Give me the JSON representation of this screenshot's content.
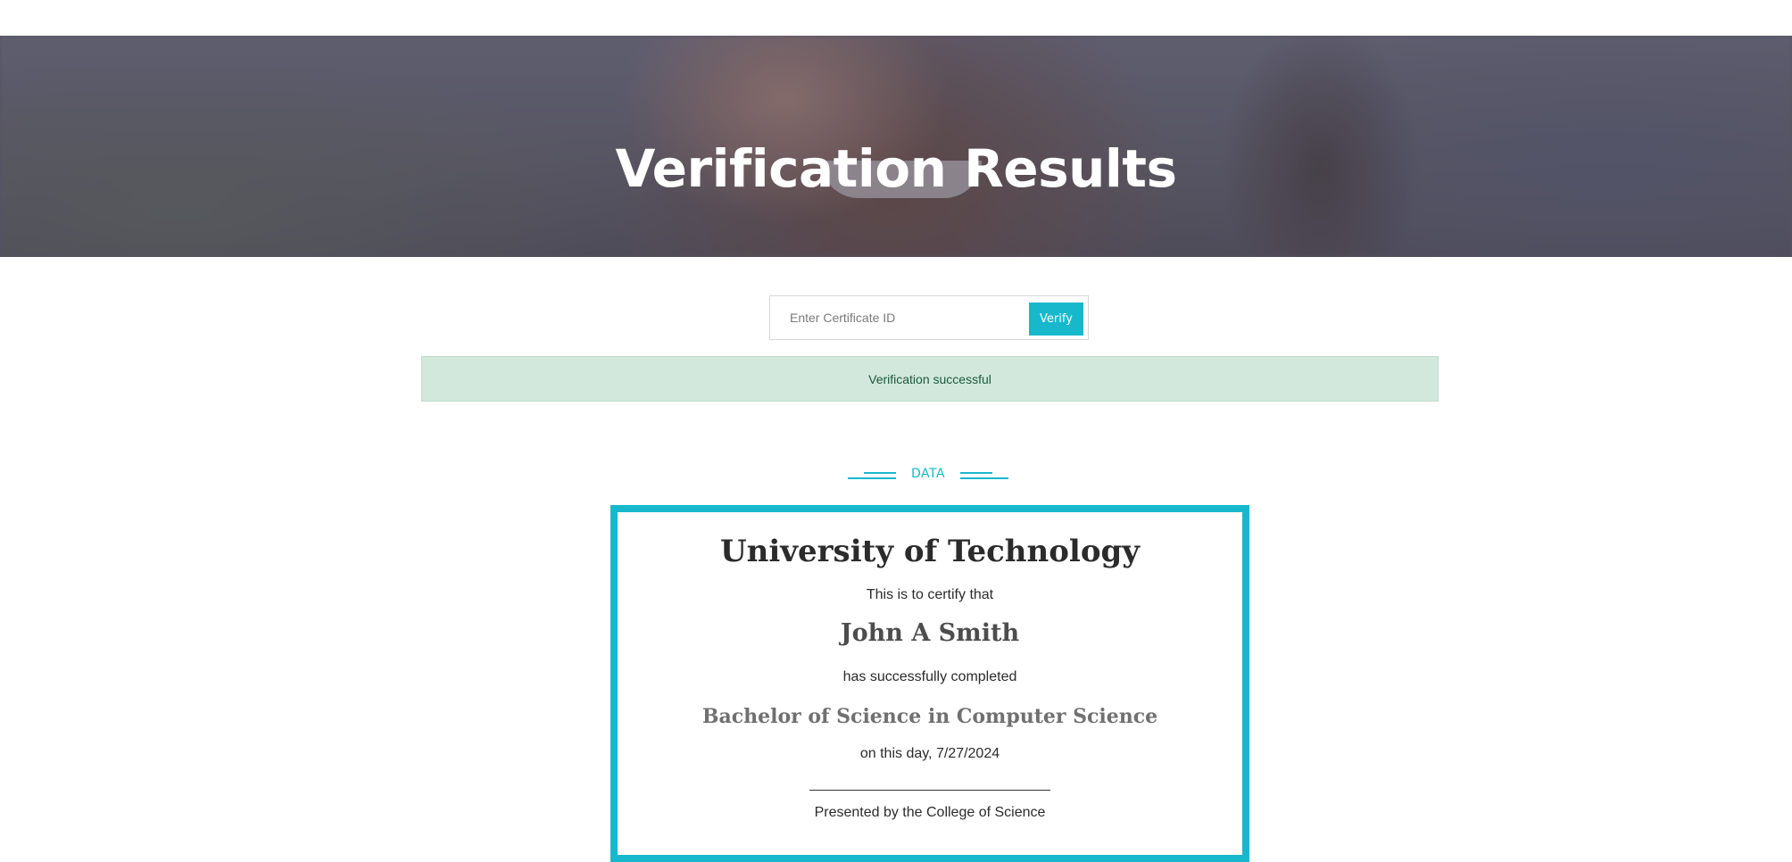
{
  "hero": {
    "title": "Verification Results"
  },
  "search": {
    "placeholder": "Enter Certificate ID",
    "value": "",
    "button_label": "Verify"
  },
  "alert": {
    "message": "Verification successful"
  },
  "section": {
    "label": "DATA"
  },
  "certificate": {
    "university": "University of Technology",
    "intro": "This is to certify that",
    "recipient": "John A Smith",
    "completion": "has successfully completed",
    "program": "Bachelor of Science in Computer Science",
    "date_line": "on this day, 7/27/2024",
    "presented_by": "Presented by the College of Science"
  },
  "colors": {
    "accent": "#18b8cc",
    "alert_bg": "#d3e8dd",
    "alert_text": "#1a5a3a"
  }
}
